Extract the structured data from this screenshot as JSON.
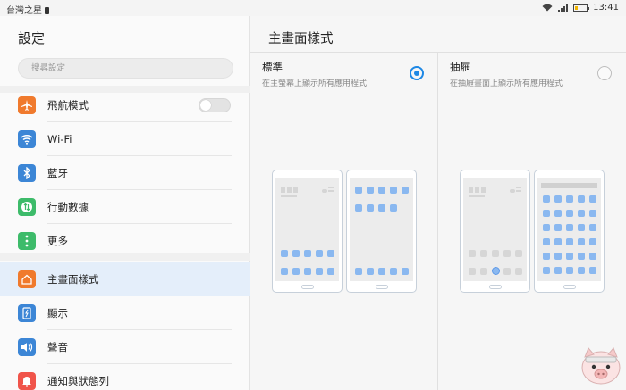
{
  "statusbar": {
    "carrier": "台灣之星",
    "time": "13:41"
  },
  "sidebar": {
    "title": "設定",
    "search_placeholder": "搜尋設定",
    "items": [
      {
        "label": "飛航模式",
        "icon": "airplane-icon",
        "color": "#f07a2d"
      },
      {
        "label": "Wi-Fi",
        "icon": "wifi-icon",
        "color": "#3c86d6"
      },
      {
        "label": "藍牙",
        "icon": "bluetooth-icon",
        "color": "#3c86d6"
      },
      {
        "label": "行動數據",
        "icon": "mobile-data-icon",
        "color": "#3dbb6a"
      },
      {
        "label": "更多",
        "icon": "more-icon",
        "color": "#3dbb6a"
      },
      {
        "label": "主畫面樣式",
        "icon": "home-icon",
        "color": "#f07a2d"
      },
      {
        "label": "顯示",
        "icon": "display-icon",
        "color": "#3c86d6"
      },
      {
        "label": "聲音",
        "icon": "sound-icon",
        "color": "#3c86d6"
      },
      {
        "label": "通知與狀態列",
        "icon": "notification-icon",
        "color": "#f0544a"
      }
    ]
  },
  "main": {
    "title": "主畫面樣式",
    "options": [
      {
        "title": "標準",
        "desc": "在主螢幕上顯示所有應用程式",
        "selected": true
      },
      {
        "title": "抽屜",
        "desc": "在抽屜畫面上顯示所有應用程式",
        "selected": false
      }
    ]
  }
}
